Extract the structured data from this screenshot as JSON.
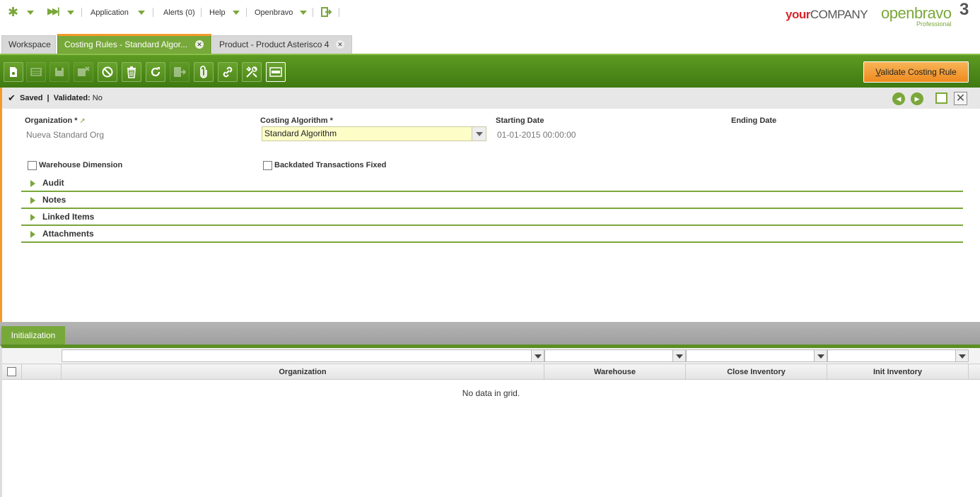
{
  "topnav": {
    "application": "Application",
    "alerts": "Alerts (0)",
    "help": "Help",
    "openbravo": "Openbravo",
    "logo_your_bold": "your",
    "logo_your_rest": "COMPANY",
    "logo_openbravo": "openbravo",
    "logo_version": "3",
    "logo_edition": "Professional"
  },
  "tabs": [
    {
      "label": "Workspace",
      "active": false,
      "closable": false
    },
    {
      "label": "Costing Rules - Standard Algor...",
      "active": true,
      "closable": true
    },
    {
      "label": "Product - Product Asterisco 4",
      "active": false,
      "closable": true
    }
  ],
  "toolbar": {
    "buttons": [
      "new-document",
      "new-row",
      "save",
      "save-close",
      "undo",
      "delete",
      "refresh",
      "export",
      "attach",
      "link",
      "tools",
      "grid-view"
    ],
    "validate_label_prefix": "V",
    "validate_label_rest": "alidate Costing Rule"
  },
  "status": {
    "saved": "Saved",
    "separator": "|",
    "validated_label": "Validated:",
    "validated_value": "No"
  },
  "form": {
    "organization_label": "Organization *",
    "organization_value": "Nueva Standard Org",
    "costing_algorithm_label": "Costing Algorithm *",
    "costing_algorithm_value": "Standard Algorithm",
    "starting_date_label": "Starting Date",
    "starting_date_value": "01-01-2015 00:00:00",
    "ending_date_label": "Ending Date",
    "warehouse_dimension_label": "Warehouse Dimension",
    "warehouse_dimension_checked": false,
    "backdated_label": "Backdated Transactions Fixed",
    "backdated_checked": false
  },
  "sections": [
    "Audit",
    "Notes",
    "Linked Items",
    "Attachments"
  ],
  "child_tab": {
    "label": "Initialization"
  },
  "grid": {
    "columns": [
      "Organization",
      "Warehouse",
      "Close Inventory",
      "Init Inventory"
    ],
    "empty_message": "No data in grid."
  },
  "colors": {
    "accent_green": "#77a83a",
    "toolbar_green": "#4f8a1b",
    "accent_orange": "#f39a2b",
    "combo_yellow": "#fdfdc8"
  }
}
